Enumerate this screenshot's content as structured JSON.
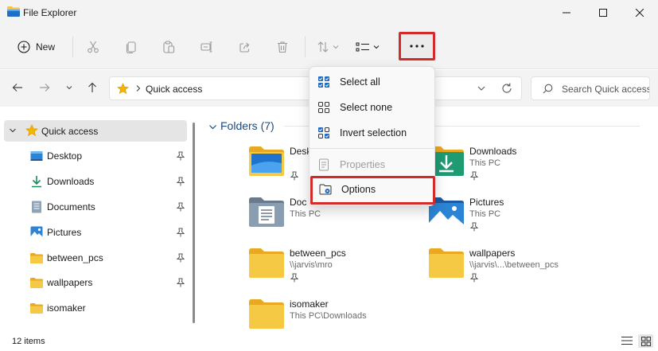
{
  "window": {
    "title": "File Explorer"
  },
  "toolbar": {
    "new_label": "New",
    "icons": [
      "cut-icon",
      "copy-icon",
      "paste-icon",
      "rename-icon",
      "share-icon",
      "delete-icon",
      "sort-icon",
      "view-icon",
      "more-options-icon"
    ]
  },
  "address": {
    "location": "Quick access"
  },
  "search": {
    "placeholder": "Search Quick access"
  },
  "sidebar": {
    "quick_access": "Quick access",
    "items": [
      {
        "label": "Desktop",
        "icon": "desktop-icon"
      },
      {
        "label": "Downloads",
        "icon": "download-arrow-icon"
      },
      {
        "label": "Documents",
        "icon": "documents-icon"
      },
      {
        "label": "Pictures",
        "icon": "pictures-icon"
      },
      {
        "label": "between_pcs",
        "icon": "folder-icon"
      },
      {
        "label": "wallpapers",
        "icon": "folder-icon"
      },
      {
        "label": "isomaker",
        "icon": "folder-icon"
      }
    ]
  },
  "content": {
    "group_title": "Folders (7)",
    "folders": [
      {
        "name": "Desk",
        "location": "",
        "pinned": true
      },
      {
        "name": "Downloads",
        "location": "This PC",
        "pinned": true
      },
      {
        "name": "Doc",
        "location": "This PC",
        "pinned": false
      },
      {
        "name": "Pictures",
        "location": "This PC",
        "pinned": true
      },
      {
        "name": "between_pcs",
        "location": "\\\\jarvis\\mro",
        "pinned": true
      },
      {
        "name": "wallpapers",
        "location": "\\\\jarvis\\...\\between_pcs",
        "pinned": true
      },
      {
        "name": "isomaker",
        "location": "This PC\\Downloads",
        "pinned": false
      }
    ]
  },
  "menu": {
    "items": [
      {
        "label": "Select all",
        "icon": "select-all-icon",
        "enabled": true
      },
      {
        "label": "Select none",
        "icon": "select-none-icon",
        "enabled": true
      },
      {
        "label": "Invert selection",
        "icon": "invert-selection-icon",
        "enabled": true
      },
      {
        "label": "Properties",
        "icon": "properties-icon",
        "enabled": false
      },
      {
        "label": "Options",
        "icon": "options-icon",
        "enabled": true
      }
    ]
  },
  "status": {
    "items_count": "12 items"
  },
  "colors": {
    "highlight_red": "#d32a2a",
    "folder_yellow": "#f3c64a",
    "accent_blue": "#1e6bc4"
  }
}
